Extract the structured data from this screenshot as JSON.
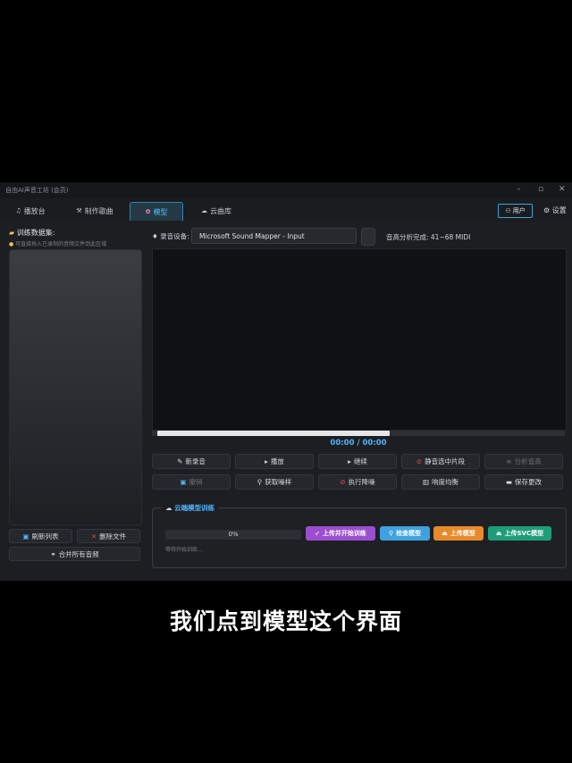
{
  "window": {
    "title": "自由AI声音工坊 (会员)"
  },
  "tabs": [
    {
      "label": "播放台",
      "icon": "♫"
    },
    {
      "label": "制作歌曲",
      "icon": "⚒"
    },
    {
      "label": "模型",
      "icon": "✿"
    },
    {
      "label": "云曲库",
      "icon": "☁"
    }
  ],
  "header": {
    "user_label": "用户",
    "settings_label": "设置"
  },
  "left": {
    "title": "训练数据集:",
    "hint": "可直接拖入已录制的音频文件到此区域",
    "refresh_label": "刷新列表",
    "delete_label": "删除文件",
    "merge_label": "合并所有音频"
  },
  "main": {
    "device_label": "录音设备:",
    "device_value": "Microsoft Sound Mapper - Input",
    "pitch_status": "音高分析完成: 41~68 MIDI",
    "time": "00:00 / 00:00",
    "row1": [
      "新录音",
      "播放",
      "继续",
      "静音选中片段",
      "分析音高"
    ],
    "row2": [
      "撤销",
      "获取噪样",
      "执行降噪",
      "响度均衡",
      "保存更改"
    ],
    "progress": 0.0,
    "progress_text": "0%",
    "cloud": {
      "title": "云端模型训练",
      "status": "等待开始训练...",
      "buttons": [
        "上传并开始训练",
        "检查模型",
        "上传模型",
        "上传SVC模型"
      ]
    }
  },
  "caption": "我们点到模型这个界面",
  "colors": {
    "accent": "#4fb3ff",
    "purple": "#9b4fd0",
    "blue": "#3fa2e0",
    "orange": "#e98a2a",
    "green": "#1e9e78"
  }
}
